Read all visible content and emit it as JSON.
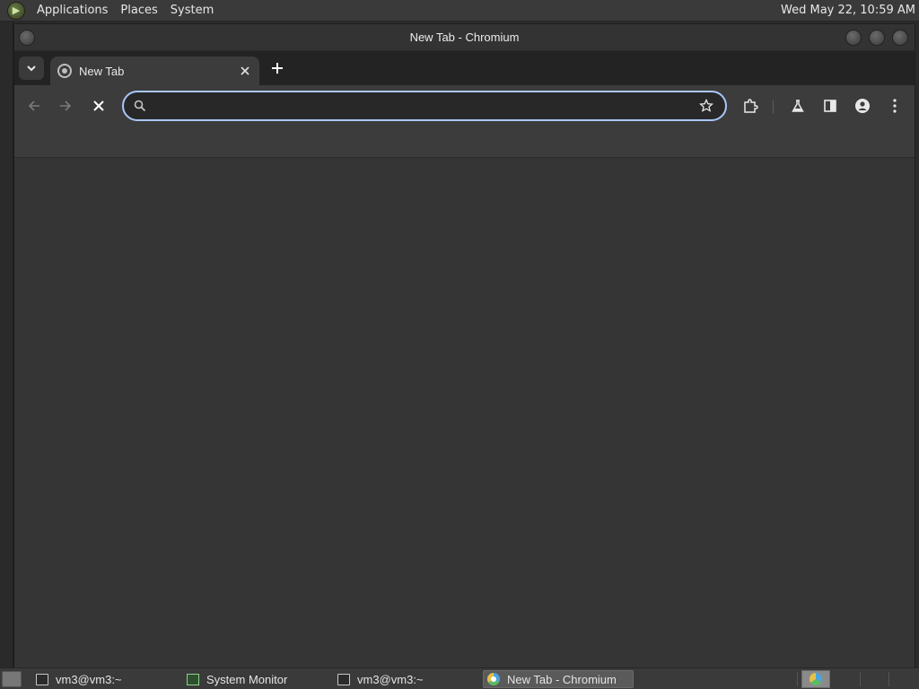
{
  "top_panel": {
    "menus": [
      "Applications",
      "Places",
      "System"
    ],
    "clock": "Wed May 22, 10:59 AM"
  },
  "window": {
    "title": "New Tab - Chromium"
  },
  "tabs": [
    {
      "label": "New Tab",
      "active": true
    }
  ],
  "toolbar": {
    "omnibox_value": "",
    "icons": [
      "back-arrow-icon",
      "forward-arrow-icon",
      "stop-icon",
      "search-icon",
      "star-icon",
      "extensions-icon",
      "labs-flask-icon",
      "side-panel-icon",
      "profile-icon",
      "more-vert-icon"
    ]
  },
  "taskbar": {
    "items": [
      {
        "label": "vm3@vm3:~",
        "icon": "terminal-icon"
      },
      {
        "label": "System Monitor",
        "icon": "system-monitor-icon"
      },
      {
        "label": "vm3@vm3:~",
        "icon": "terminal-icon"
      },
      {
        "label": "New Tab - Chromium",
        "icon": "chromium-icon",
        "active": true
      }
    ]
  },
  "colors": {
    "focus_ring": "#a8c7fa",
    "toolbar_bg": "#3c3c3c",
    "tabstrip_bg": "#232323",
    "content_bg": "#353535"
  }
}
